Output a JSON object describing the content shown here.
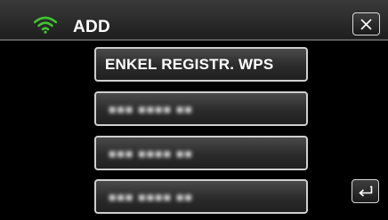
{
  "header": {
    "title": "ADD",
    "wifi_icon_color": "#3fc42f"
  },
  "toolbar": {
    "close_icon": "close-icon",
    "back_icon": "return-arrow-icon"
  },
  "list": {
    "items": [
      {
        "label": "ENKEL REGISTR. WPS"
      },
      {
        "label": "■■■ ■■■■ ■■",
        "obscured": true
      },
      {
        "label": "■■■ ■■■■ ■■",
        "obscured": true
      },
      {
        "label": "■■■ ■■■■ ■■",
        "obscured": true
      }
    ]
  },
  "colors": {
    "background": "#000000",
    "header_bg": "#2c2c2c",
    "button_border": "#cfcfcf"
  }
}
